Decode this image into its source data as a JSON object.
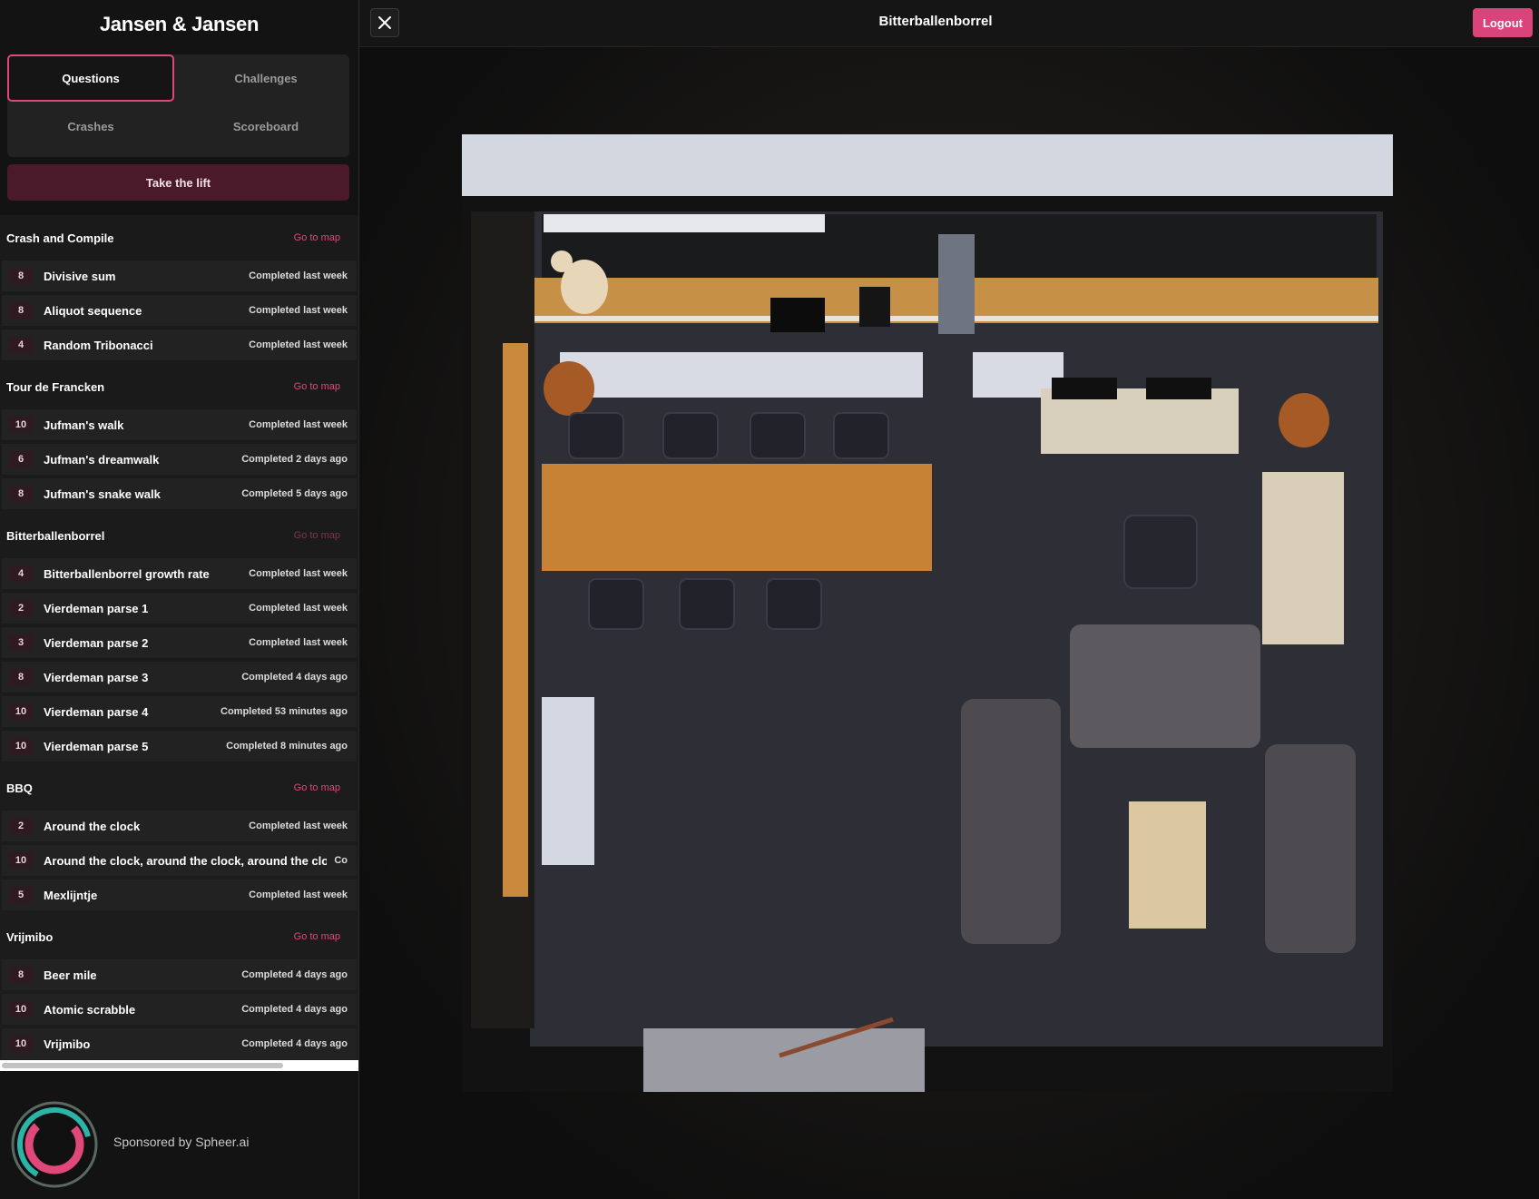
{
  "app_title": "Jansen & Jansen",
  "tabs": {
    "questions": "Questions",
    "challenges": "Challenges",
    "crashes": "Crashes",
    "scoreboard": "Scoreboard"
  },
  "lift_button": "Take the lift",
  "go_to_map": "Go to map",
  "groups": [
    {
      "title": "Crash and Compile",
      "link_dimmed": false,
      "items": [
        {
          "points": "8",
          "name": "Divisive sum",
          "status": "Completed last week"
        },
        {
          "points": "8",
          "name": "Aliquot sequence",
          "status": "Completed last week"
        },
        {
          "points": "4",
          "name": "Random Tribonacci",
          "status": "Completed last week"
        }
      ]
    },
    {
      "title": "Tour de Francken",
      "link_dimmed": false,
      "items": [
        {
          "points": "10",
          "name": "Jufman's walk",
          "status": "Completed last week"
        },
        {
          "points": "6",
          "name": "Jufman's dreamwalk",
          "status": "Completed 2 days ago"
        },
        {
          "points": "8",
          "name": "Jufman's snake walk",
          "status": "Completed 5 days ago"
        }
      ]
    },
    {
      "title": "Bitterballenborrel",
      "link_dimmed": true,
      "items": [
        {
          "points": "4",
          "name": "Bitterballenborrel growth rate",
          "status": "Completed last week"
        },
        {
          "points": "2",
          "name": "Vierdeman parse 1",
          "status": "Completed last week"
        },
        {
          "points": "3",
          "name": "Vierdeman parse 2",
          "status": "Completed last week"
        },
        {
          "points": "8",
          "name": "Vierdeman parse 3",
          "status": "Completed 4 days ago"
        },
        {
          "points": "10",
          "name": "Vierdeman parse 4",
          "status": "Completed 53 minutes ago"
        },
        {
          "points": "10",
          "name": "Vierdeman parse 5",
          "status": "Completed 8 minutes ago"
        }
      ]
    },
    {
      "title": "BBQ",
      "link_dimmed": false,
      "items": [
        {
          "points": "2",
          "name": "Around the clock",
          "status": "Completed last week"
        },
        {
          "points": "10",
          "name": "Around the clock, around the clock, around the clock, ...",
          "status": "Co"
        },
        {
          "points": "5",
          "name": "Mexlijntje",
          "status": "Completed last week"
        }
      ]
    },
    {
      "title": "Vrijmibo",
      "link_dimmed": false,
      "items": [
        {
          "points": "8",
          "name": "Beer mile",
          "status": "Completed 4 days ago"
        },
        {
          "points": "10",
          "name": "Atomic scrabble",
          "status": "Completed 4 days ago"
        },
        {
          "points": "10",
          "name": "Vrijmibo",
          "status": "Completed 4 days ago"
        }
      ]
    }
  ],
  "sponsor_text": "Sponsored by Spheer.ai",
  "map_title": "Bitterballenborrel",
  "logout_label": "Logout",
  "icons": {
    "close": "close-icon",
    "sponsor_logo": "spheer-logo"
  },
  "colors": {
    "accent": "#e0487a",
    "lift_button_bg": "#4a1a2b",
    "logout_bg": "#d9457a",
    "background": "#131313"
  }
}
